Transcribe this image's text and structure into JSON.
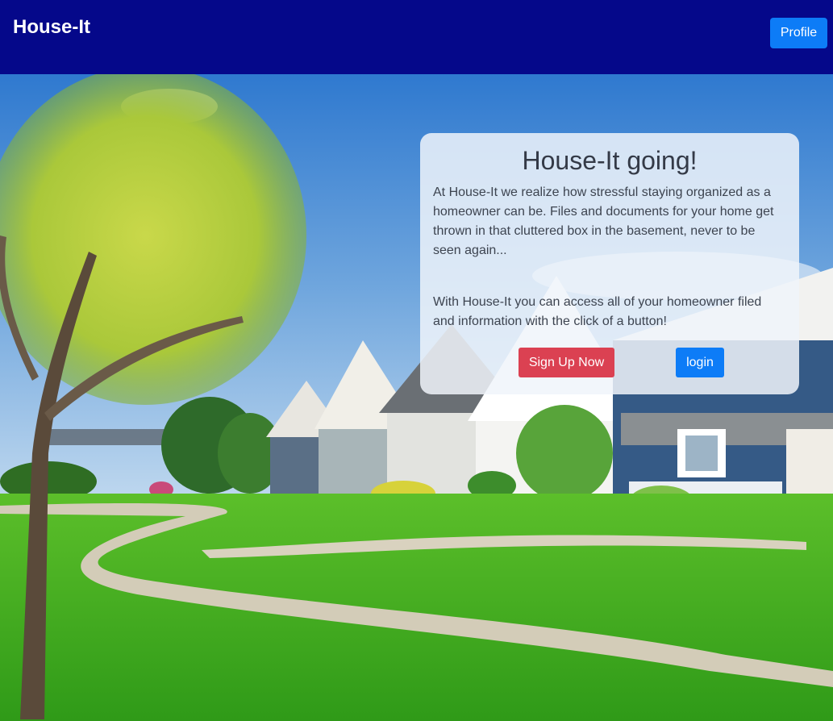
{
  "navbar": {
    "brand": "House-It",
    "profile_label": "Profile"
  },
  "hero": {
    "image": "suburban-houses-lawn-background"
  },
  "card": {
    "title": "House-It going!",
    "paragraph1": "At House-It we realize how stressful staying organized as a homeowner can be. Files and documents for your home get thrown in that cluttered box in the basement, never to be seen again...",
    "paragraph2": "With House-It you can access all of your homeowner filed and information with the click of a button!",
    "signup_label": "Sign Up Now",
    "login_label": "login"
  },
  "colors": {
    "navbar_bg": "#05088a",
    "primary_button": "#0d7cf7",
    "signup_button": "#db4152",
    "card_bg": "rgba(240,244,250,0.85)"
  }
}
